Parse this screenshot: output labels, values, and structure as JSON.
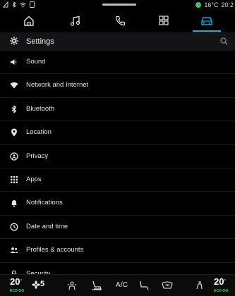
{
  "status": {
    "temperature": "16°C",
    "time": "20:2",
    "colors": {
      "indicator": "#39c36a"
    }
  },
  "topnav": {
    "items": [
      {
        "icon": "home-icon"
      },
      {
        "icon": "music-icon"
      },
      {
        "icon": "phone-icon"
      },
      {
        "icon": "apps-grid-icon"
      },
      {
        "icon": "car-icon",
        "active": true
      }
    ],
    "accent": "#00b6e6"
  },
  "header": {
    "title": "Settings",
    "icon": "gear-icon",
    "search_icon": "search-icon"
  },
  "settings": {
    "items": [
      {
        "label": "Sound",
        "icon": "speaker-icon"
      },
      {
        "label": "Network and Internet",
        "icon": "wifi-icon"
      },
      {
        "label": "Bluetooth",
        "icon": "bluetooth-icon"
      },
      {
        "label": "Location",
        "icon": "location-pin-icon"
      },
      {
        "label": "Privacy",
        "icon": "shield-icon"
      },
      {
        "label": "Apps",
        "icon": "apps-grid-icon"
      },
      {
        "label": "Notifications",
        "icon": "bell-icon"
      },
      {
        "label": "Date and time",
        "icon": "clock-icon"
      },
      {
        "label": "Profiles & accounts",
        "icon": "people-icon"
      },
      {
        "label": "Security",
        "icon": "lock-icon"
      }
    ]
  },
  "climate": {
    "left_temp": "20",
    "left_unit": "°",
    "left_eco": "ECO-OO",
    "fan_level": "5",
    "ac_label": "A/C",
    "right_temp": "20",
    "right_unit": "°",
    "right_eco": "ECO-OO",
    "eco_color": "#3bd16f"
  }
}
